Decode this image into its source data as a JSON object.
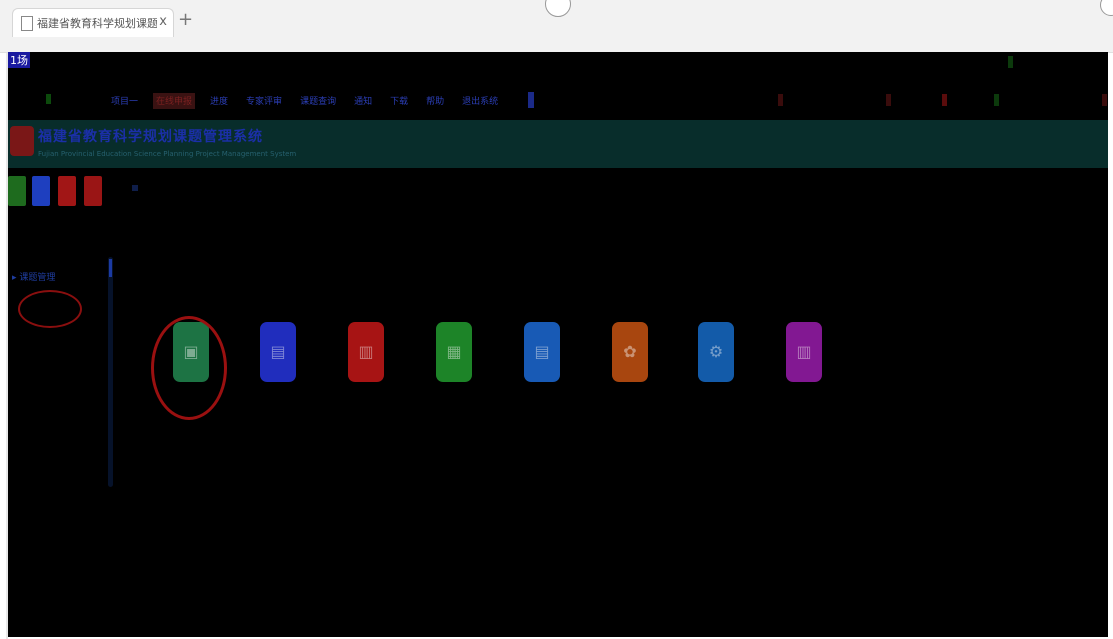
{
  "browser": {
    "tab_title": "福建省教育科学规划课题管理系",
    "tab_close": "x",
    "new_tab": "+"
  },
  "page": {
    "corner_text": "1场",
    "nav_items": [
      "项目一",
      "在线申报",
      "进度",
      "专家评审",
      "课题查询",
      "通知",
      "下载",
      "帮助",
      "退出系统"
    ],
    "banner": {
      "title": "福建省教育科学规划课题管理系统",
      "subtitle": "Fujian Provincial Education Science Planning Project Management System"
    },
    "quick_buttons": [
      {
        "label": "",
        "color": "#1e6b1e"
      },
      {
        "label": "",
        "color": "#1e3fbf"
      },
      {
        "label": "",
        "color": "#a11616"
      },
      {
        "label": "",
        "color": "#9a1515"
      }
    ],
    "sidebar_label": "▸ 课题管理",
    "modules": [
      {
        "name": "module-1",
        "color": "#1f7a48",
        "icon": "document-icon",
        "glyph": "▣"
      },
      {
        "name": "module-2",
        "color": "#2230c8",
        "icon": "list-icon",
        "glyph": "▤"
      },
      {
        "name": "module-3",
        "color": "#b01616",
        "icon": "list-icon",
        "glyph": "▥"
      },
      {
        "name": "module-4",
        "color": "#1f8c2b",
        "icon": "list-icon",
        "glyph": "▦"
      },
      {
        "name": "module-5",
        "color": "#1a5fbf",
        "icon": "list-icon",
        "glyph": "▤"
      },
      {
        "name": "module-6",
        "color": "#b24a10",
        "icon": "gear-icon",
        "glyph": "✿"
      },
      {
        "name": "module-7",
        "color": "#1560b3",
        "icon": "settings-icon",
        "glyph": "⚙"
      },
      {
        "name": "module-8",
        "color": "#8a1a9a",
        "icon": "list-icon",
        "glyph": "▥"
      }
    ],
    "colors": {
      "background": "#000000",
      "banner": "#082d2b",
      "annotation_ring": "#9a1010"
    }
  }
}
